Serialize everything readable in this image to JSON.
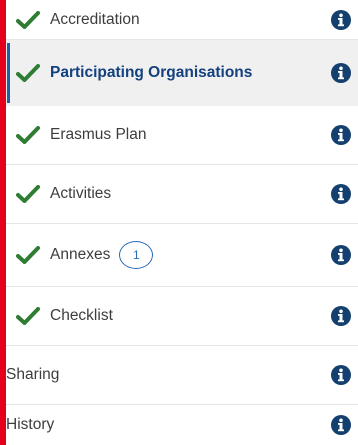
{
  "colors": {
    "accent_red": "#e4001b",
    "active_bar": "#1f5ea8",
    "check_green": "#2e7d32",
    "info_navy": "#13406e"
  },
  "items": [
    {
      "label": "Accreditation",
      "checked": true,
      "active": false,
      "badge": null
    },
    {
      "label": "Participating Organisations",
      "checked": true,
      "active": true,
      "badge": null
    },
    {
      "label": "Erasmus Plan",
      "checked": true,
      "active": false,
      "badge": null
    },
    {
      "label": "Activities",
      "checked": true,
      "active": false,
      "badge": null
    },
    {
      "label": "Annexes",
      "checked": true,
      "active": false,
      "badge": "1"
    },
    {
      "label": "Checklist",
      "checked": true,
      "active": false,
      "badge": null
    },
    {
      "label": "Sharing",
      "checked": false,
      "active": false,
      "badge": null
    },
    {
      "label": "History",
      "checked": false,
      "active": false,
      "badge": null
    }
  ],
  "icons": {
    "check": "check-icon",
    "info": "info-circle-icon"
  }
}
